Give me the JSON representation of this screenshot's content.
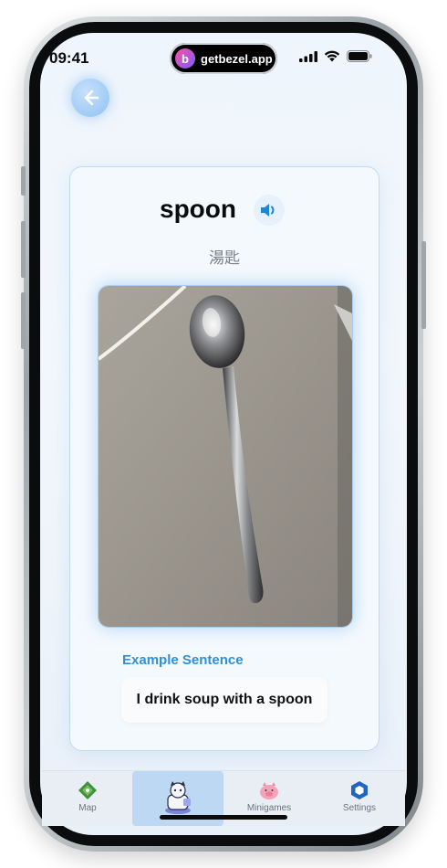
{
  "status_bar": {
    "time": "09:41",
    "island_url": "getbezel.app",
    "island_logo_letter": "b",
    "icons": [
      "cellular-signal-icon",
      "wifi-icon",
      "battery-icon"
    ]
  },
  "header": {
    "back_icon": "back-arrow-icon"
  },
  "card": {
    "word": "spoon",
    "speaker_icon": "speaker-icon",
    "translation": "湯匙",
    "image_description_icon": "spoon-photo",
    "example_label": "Example Sentence",
    "example_sentence": "I drink soup with a spoon"
  },
  "tabbar": {
    "tabs": [
      {
        "label": "Map",
        "icon": "map-icon"
      },
      {
        "label": "",
        "icon": "character-avatar-icon",
        "active": true
      },
      {
        "label": "Minigames",
        "icon": "pig-icon"
      },
      {
        "label": "Settings",
        "icon": "hexagon-settings-icon"
      }
    ]
  },
  "colors": {
    "accent": "#2f8fd8",
    "card_border": "#bcdcf6",
    "active_tab": "#bcd8f3"
  }
}
